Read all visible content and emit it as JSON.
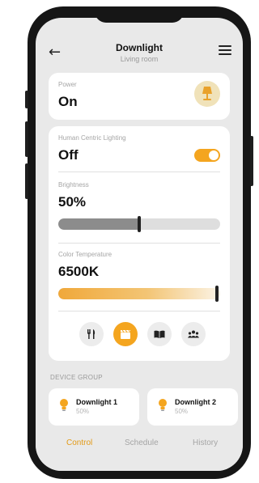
{
  "header": {
    "back_icon": "arrow-left-icon",
    "title": "Downlight",
    "subtitle": "Living room",
    "menu_icon": "hamburger-menu-icon"
  },
  "power": {
    "label": "Power",
    "value": "On",
    "icon": "lamp-icon"
  },
  "hcl": {
    "label": "Human Centric Lighting",
    "value": "Off",
    "toggle_on": true
  },
  "brightness": {
    "label": "Brightness",
    "value": "50%",
    "level": 0.5
  },
  "color_temperature": {
    "label": "Color Temperature",
    "value": "6500K",
    "level": 1.0
  },
  "scenes": [
    {
      "icon": "restaurant-icon",
      "active": false
    },
    {
      "icon": "clapperboard-icon",
      "active": true
    },
    {
      "icon": "book-icon",
      "active": false
    },
    {
      "icon": "group-icon",
      "active": false
    }
  ],
  "device_group": {
    "label": "DEVICE GROUP",
    "items": [
      {
        "name": "Downlight 1",
        "value": "50%",
        "icon": "bulb-icon"
      },
      {
        "name": "Downlight 2",
        "value": "50%",
        "icon": "bulb-icon"
      }
    ]
  },
  "tabs": [
    {
      "label": "Control",
      "active": true
    },
    {
      "label": "Schedule",
      "active": false
    },
    {
      "label": "History",
      "active": false
    }
  ],
  "colors": {
    "accent": "#f4a51f",
    "background": "#e9e9e9",
    "frame": "#161616"
  }
}
